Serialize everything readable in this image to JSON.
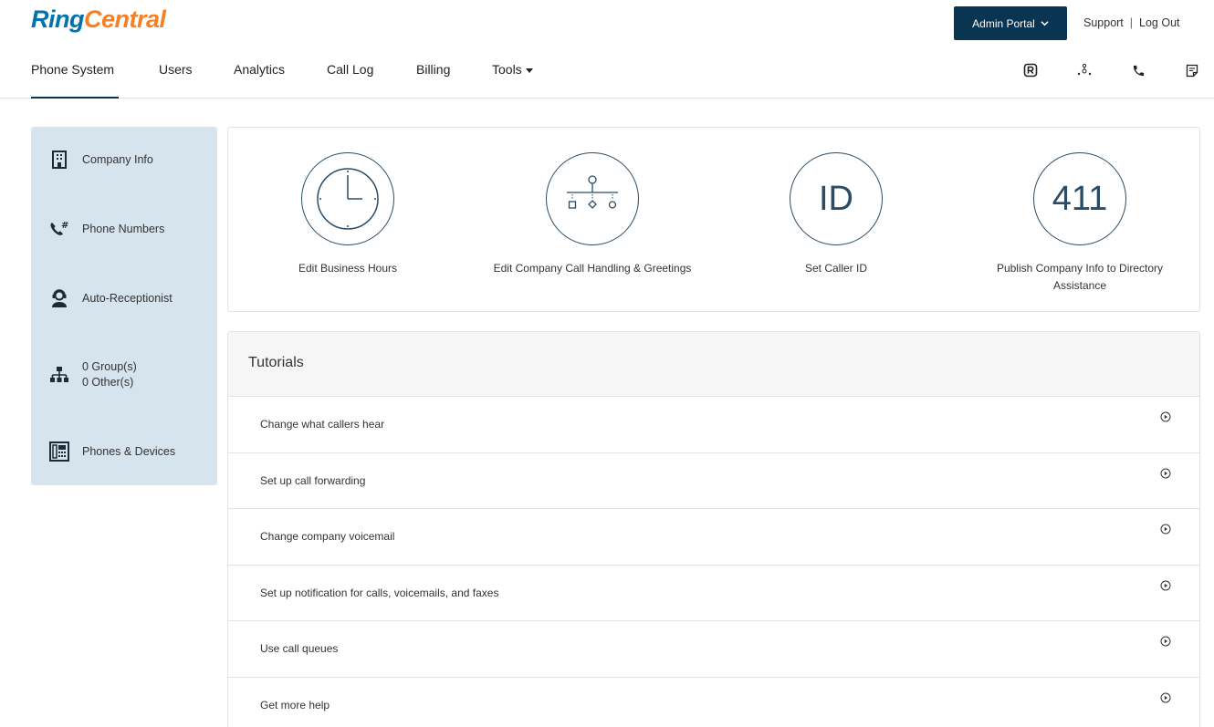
{
  "header": {
    "logo_part1": "Ring",
    "logo_part2": "Central",
    "admin_button": "Admin Portal",
    "support": "Support",
    "separator": "|",
    "logout": "Log Out"
  },
  "nav": {
    "items": [
      "Phone System",
      "Users",
      "Analytics",
      "Call Log",
      "Billing",
      "Tools"
    ],
    "active": "Phone System",
    "icons": [
      "ringcentral-app-icon",
      "network-icon",
      "phone-icon",
      "notes-icon"
    ]
  },
  "sidebar": {
    "company_info": "Company Info",
    "phone_numbers": "Phone Numbers",
    "auto_receptionist": "Auto-Receptionist",
    "groups": "0 Group(s)",
    "others": "0 Other(s)",
    "phones_devices": "Phones & Devices"
  },
  "actions": {
    "business_hours": "Edit Business Hours",
    "call_handling": "Edit Company Call Handling & Greetings",
    "caller_id_glyph": "ID",
    "caller_id": "Set Caller ID",
    "directory_glyph": "411",
    "directory_line1": "Publish Company Info to Directory",
    "directory_line2": "Assistance"
  },
  "tutorials": {
    "title": "Tutorials",
    "items": [
      "Change what callers hear",
      "Set up call forwarding",
      "Change company voicemail",
      "Set up notification for calls, voicemails, and faxes",
      "Use call queues",
      "Get more help"
    ]
  },
  "colors": {
    "brand_blue": "#0073ae",
    "brand_orange": "#f58025",
    "admin_button_bg": "#0a3552",
    "sidebar_bg": "#d6e4ee",
    "icon_stroke": "#2b4c64"
  }
}
